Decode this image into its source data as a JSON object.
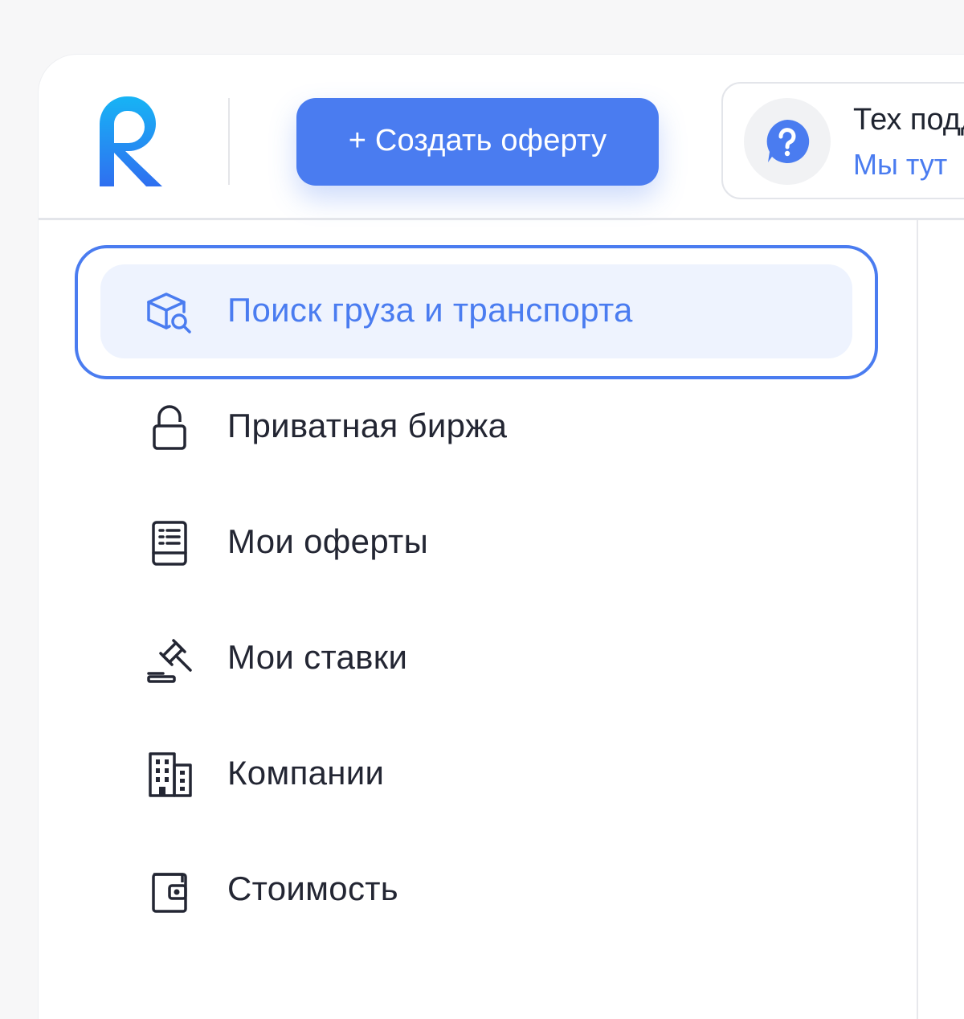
{
  "header": {
    "logo_letter": "R",
    "create_button_label": "+ Создать оферту",
    "support": {
      "title": "Тех поддержка",
      "subtitle": "Мы тут"
    }
  },
  "menu": {
    "items": [
      {
        "label": "Поиск груза и транспорта",
        "icon": "cargo-search-icon",
        "active": true
      },
      {
        "label": "Приватная биржа",
        "icon": "lock-icon",
        "active": false
      },
      {
        "label": "Мои оферты",
        "icon": "document-list-icon",
        "active": false
      },
      {
        "label": "Мои ставки",
        "icon": "gavel-icon",
        "active": false
      },
      {
        "label": "Компании",
        "icon": "building-icon",
        "active": false
      },
      {
        "label": "Стоимость",
        "icon": "wallet-icon",
        "active": false
      }
    ]
  },
  "colors": {
    "accent": "#4a7cf0",
    "active_bg": "#eef3fe",
    "text": "#232633",
    "logo_gradient_top": "#17b4f5",
    "logo_gradient_bottom": "#2f6ff0"
  }
}
